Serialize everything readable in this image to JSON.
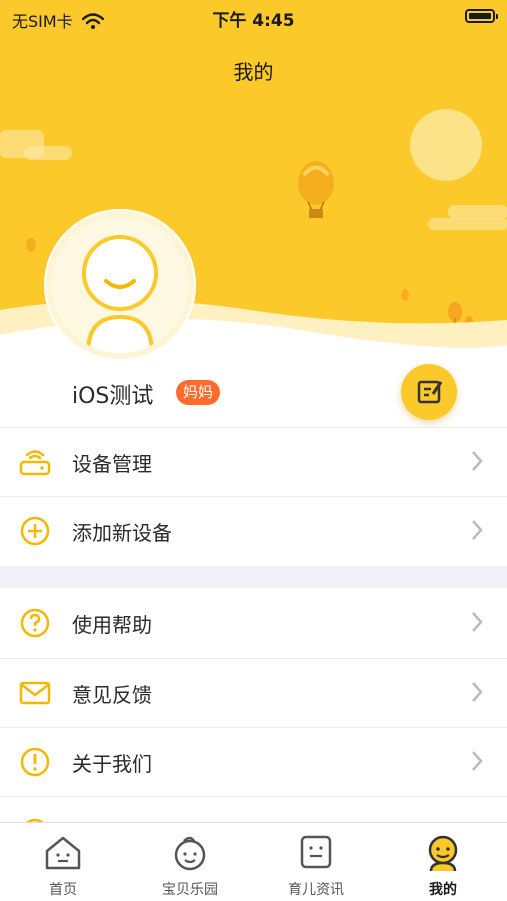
{
  "status_bar": {
    "carrier": "无SIM卡",
    "time": "下午 4:45"
  },
  "nav": {
    "title": "我的"
  },
  "profile": {
    "name": "iOS测试",
    "role": "妈妈"
  },
  "menu": [
    {
      "label": "设备管理",
      "icon": "router-icon"
    },
    {
      "label": "添加新设备",
      "icon": "plus-circle-icon"
    },
    {
      "label": "使用帮助",
      "icon": "help-circle-icon"
    },
    {
      "label": "意见反馈",
      "icon": "mail-icon"
    },
    {
      "label": "关于我们",
      "icon": "info-circle-icon"
    }
  ],
  "tabs": [
    {
      "label": "首页",
      "icon": "home-icon",
      "active": false
    },
    {
      "label": "宝贝乐园",
      "icon": "baby-icon",
      "active": false
    },
    {
      "label": "育儿资讯",
      "icon": "news-icon",
      "active": false
    },
    {
      "label": "我的",
      "icon": "profile-icon",
      "active": true
    }
  ],
  "colors": {
    "accent": "#FCC92A",
    "badge": "#FF6B2C",
    "icon": "#F5B800"
  }
}
